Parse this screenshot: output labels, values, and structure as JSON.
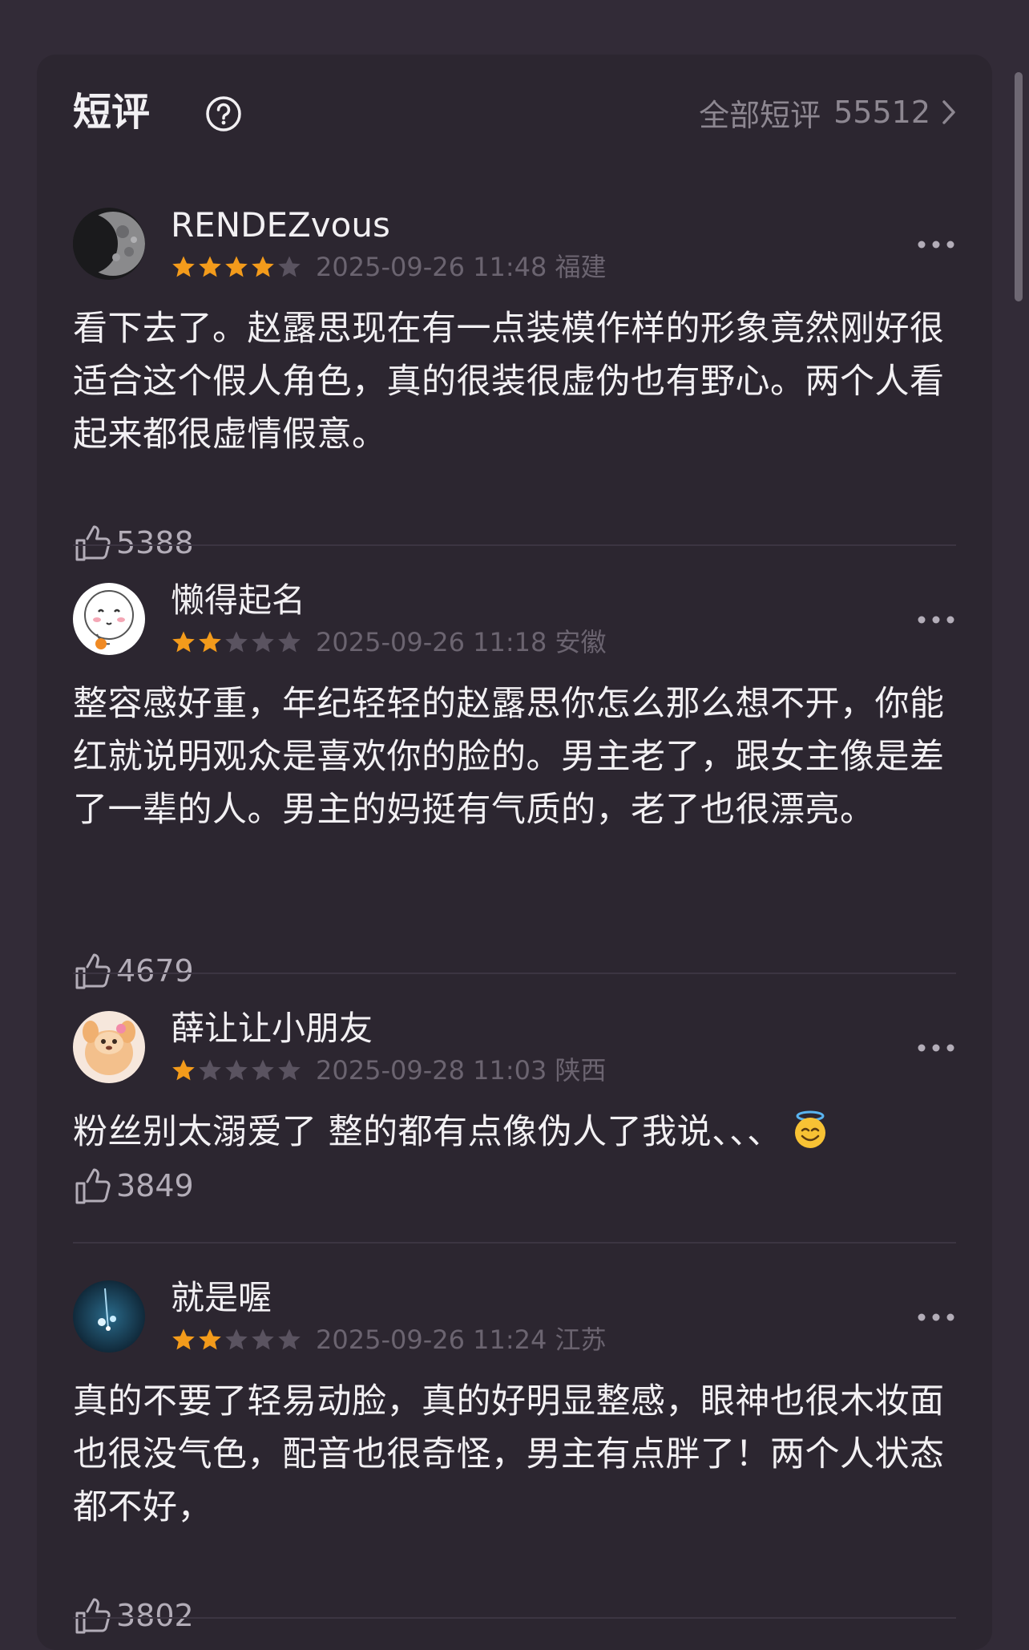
{
  "header": {
    "title": "短评",
    "all_label": "全部短评",
    "all_count": "55512"
  },
  "reviews": [
    {
      "username": "RENDEZvous",
      "rating": 4,
      "timestamp": "2025-09-26 11:48 福建",
      "text": "看下去了。赵露思现在有一点装模作样的形象竟然刚好很适合这个假人角色，真的很装很虚伪也有野心。两个人看起来都很虚情假意。",
      "likes": "5388"
    },
    {
      "username": "懒得起名",
      "rating": 2,
      "timestamp": "2025-09-26 11:18 安徽",
      "text": "整容感好重，年纪轻轻的赵露思你怎么那么想不开，你能红就说明观众是喜欢你的脸的。男主老了，跟女主像是差了一辈的人。男主的妈挺有气质的，老了也很漂亮。",
      "likes": "4679"
    },
    {
      "username": "薛让让小朋友",
      "rating": 1,
      "timestamp": "2025-09-28 11:03 陕西",
      "text": "粉丝别太溺爱了  整的都有点像伪人了我说、、、",
      "likes": "3849"
    },
    {
      "username": "就是喔",
      "rating": 2,
      "timestamp": "2025-09-26 11:24 江苏",
      "text": "真的不要了轻易动脸，真的好明显整感，眼神也很木妆面也很没气色，配音也很奇怪，男主有点胖了！两个人状态都不好，",
      "likes": "3802"
    }
  ],
  "colors": {
    "background": "#322b37",
    "card": "#2c2630",
    "star_filled": "#f39b1b",
    "star_empty": "#5a5360"
  }
}
